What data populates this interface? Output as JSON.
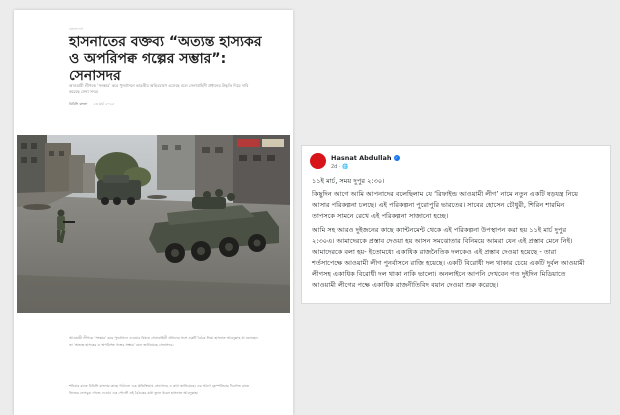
{
  "article": {
    "kicker": "বাংলাদেশ",
    "headline": "হাসনাতের বক্তব্য “অত্যন্ত হাস্যকর ও অপরিপক্ব গল্পের সম্ভার”: সেনাসদর",
    "summary": "আওয়ামী লীগকে ‘সংস্কার’ করে পুনর্বাসনে ভারতীয় অভিযোগে এসেছে বলে সেনাবাহিনী প্রধানের উদ্ধৃতি দিয়ে দাবি করেছে সেনা সদর।",
    "byline_source": "বিবিসি বাংলা",
    "byline_date": "২৩ মার্চ ২০২৫",
    "para1": "আওয়ামী লীগকে ‘সংস্কার’ করে পুনর্বাসনে দেওয়ার বিষয়ে সেনাবাহিনী প্রধানের সঙ্গে একটি বৈঠক নিয়ে হাসনাত আবদুল্লাহ যা বলেছেন তা ‘অত্যন্ত হাস্যকর ও অপরিপক্ব গল্পের সম্ভার’ বলে জানিয়েছে সেনাসদর।",
    "para2": "শনিবার রাতে বিবিসি বাংলার কাছে পাঠানো এক প্রতিক্রিয়ায় সেনাসদর এ কথা জানিয়েছে। এর আগে বৃহস্পতিবার দিবাগত রাতে নিজের ফেসবুক পেজে দেওয়া এক পোস্টে ওই বৈঠকের কথা তুলে ধরেন হাসনাত আবদুল্লাহ।"
  },
  "post": {
    "author": "Hasnat Abdullah",
    "verified_icon": "✓",
    "meta": "2d · 🌐",
    "lines": [
      "১১ই মার্চ, সময় দুপুর ২:৩০।",
      "কিছুদিন আগে আমি আপনাদের বলেছিলাম যে ‘রিফাইন্ড আওয়ামী লীগ’ নামে নতুন একটি ষড়যন্ত্র নিয়ে",
      "আসার পরিকল্পনা চলছে। এই পরিকল্পনা পুরোপুরি ভারতের। সাবের হোসেন চৌধুরী, শিরিন শারমিন",
      "তাপসকে সামনে রেখে এই পরিকল্পনা সাজানো হচ্ছে।",
      "আমি সহ আরও দুইজনের কাছে ক্যান্টনমেন্ট থেকে এই পরিকল্পনা উপস্থাপন করা হয় ১১ই মার্চ দুপুর",
      "২:৩০এ। আমাদেরকে প্রস্তাব দেওয়া হয় আসন সমঝোতার বিনিময়ে আমরা যেন এই প্রস্তাব মেনে নিই।",
      "আমাদেরকে বলা হয়- ইতোমধ্যে একাধিক রাজনৈতিক দলকেও এই প্রস্তাব দেওয়া হয়েছে - তারা",
      "শর্তসাপেক্ষে আওয়ামী লীগ পুনর্বাসনে রাজি হয়েছে। একটি বিরোধী দল থাকার চেয়ে একটি দুর্বল আওয়ামী",
      "লীগসহ একাধিক বিরোধী দল থাকা নাকি ভালো। অনলাইনে আপনি দেখবেন গত দুইদিন মিডিয়াতে",
      "আওয়ামী লীগের পক্ষে একাধিক রাজনীতিবিদ বয়ান দেওয়া শুরু করেছে।"
    ]
  }
}
